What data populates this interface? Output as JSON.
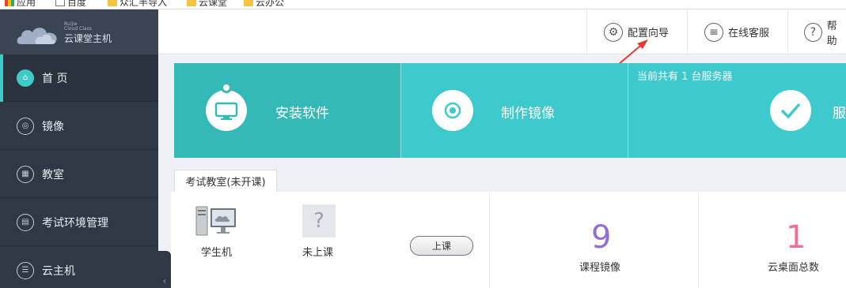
{
  "bookmarks": [
    {
      "label": "应用",
      "icon": "apps-icon"
    },
    {
      "label": "百度",
      "icon": "page-icon"
    },
    {
      "label": "众汇半导入",
      "icon": "folder-icon"
    },
    {
      "label": "云课堂",
      "icon": "folder-icon"
    },
    {
      "label": "云办公",
      "icon": "folder-icon"
    }
  ],
  "logo": {
    "en_line1": "Ruijie",
    "en_line2": "Cloud Class",
    "cn": "云课堂主机"
  },
  "sidebar": {
    "items": [
      {
        "label": "首 页",
        "icon": "home-icon",
        "glyph": "⌂",
        "active": true
      },
      {
        "label": "镜像",
        "icon": "disc-icon",
        "glyph": "◎",
        "active": false
      },
      {
        "label": "教室",
        "icon": "building-icon",
        "glyph": "▦",
        "active": false
      },
      {
        "label": "考试环境管理",
        "icon": "exam-env-icon",
        "glyph": "▤",
        "active": false
      },
      {
        "label": "云主机",
        "icon": "server-icon",
        "glyph": "☰",
        "active": false
      }
    ],
    "collapse_glyph": "‹"
  },
  "header": {
    "config_wizard": "配置向导",
    "online_service": "在线客服",
    "help": "帮助"
  },
  "banner": {
    "install": "安装软件",
    "make_image": "制作镜像",
    "server_note": "当前共有 1 台服务器",
    "server_tile": "服"
  },
  "exam_room": {
    "tab": "考试教室(未开课)",
    "student_pc": "学生机",
    "not_in_class": "未上课",
    "start_class": "上课"
  },
  "stats": [
    {
      "value": "9",
      "label": "课程镜像",
      "color": "#8f6fd6"
    },
    {
      "value": "1",
      "label": "云桌面总数",
      "color": "#ee6e9c"
    }
  ],
  "colors": {
    "accent": "#3ec9cc",
    "sidebar": "#2f3845",
    "annotation": "#e53935"
  }
}
